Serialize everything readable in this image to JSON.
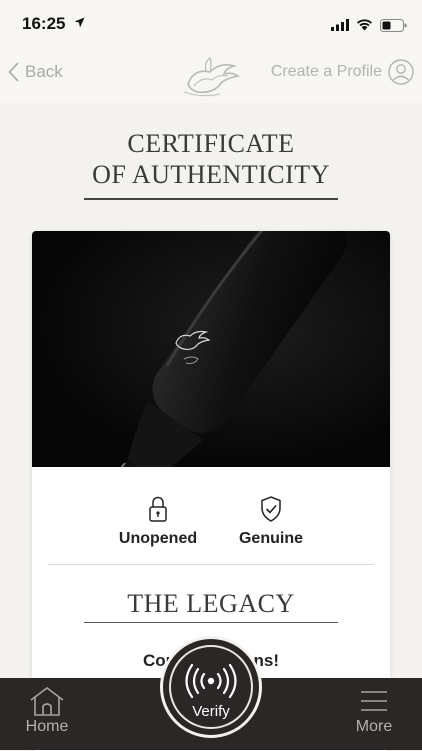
{
  "status_bar": {
    "time": "16:25"
  },
  "nav": {
    "back_label": "Back",
    "create_profile_label": "Create a Profile"
  },
  "certificate": {
    "title_line1": "CERTIFICATE",
    "title_line2": "OF AUTHENTICITY"
  },
  "card": {
    "status_items": [
      {
        "label": "Unopened",
        "icon": "lock-icon"
      },
      {
        "label": "Genuine",
        "icon": "shield-check-icon"
      }
    ],
    "wine_name": "THE LEGACY",
    "congrats_text": "Congratulations!"
  },
  "tab_bar": {
    "home_label": "Home",
    "verify_label": "Verify",
    "more_label": "More"
  },
  "colors": {
    "background": "#f3f2ee",
    "tab_bar": "#2b2726",
    "text_dark": "#2b2b2b",
    "text_muted": "#a9a9a9"
  }
}
